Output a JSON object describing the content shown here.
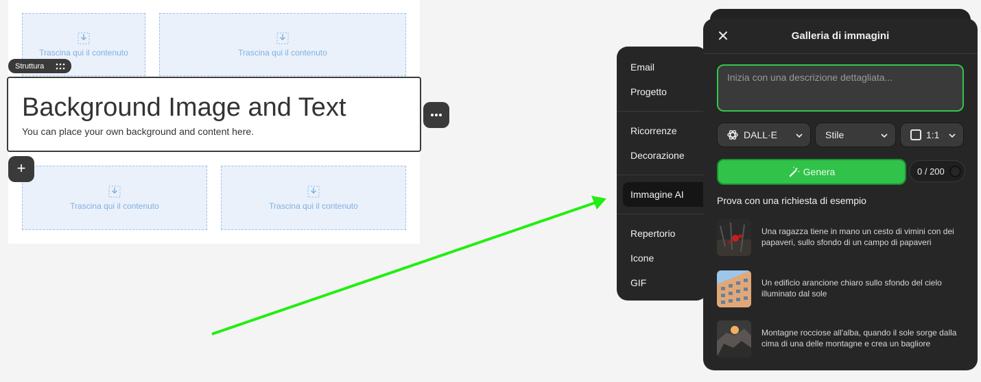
{
  "canvas": {
    "dropzone_text": "Trascina qui il contenuto",
    "structure_badge": "Struttura",
    "block": {
      "headline": "Background Image and Text",
      "subtext": "You can place your own background and content here."
    },
    "add_button": "+"
  },
  "side_menu": {
    "items": [
      {
        "label": "Email"
      },
      {
        "label": "Progetto"
      },
      {
        "label": "Ricorrenze"
      },
      {
        "label": "Decorazione"
      },
      {
        "label": "Immagine AI",
        "active": true
      },
      {
        "label": "Repertorio"
      },
      {
        "label": "Icone"
      },
      {
        "label": "GIF"
      }
    ]
  },
  "gallery": {
    "title": "Galleria di immagini",
    "prompt_placeholder": "Inizia con una descrizione dettagliata...",
    "model": "DALL·E",
    "style": "Stile",
    "ratio": "1:1",
    "generate_label": "Genera",
    "counter": "0 / 200",
    "examples_title": "Prova con una richiesta di esempio",
    "examples": [
      {
        "text": "Una ragazza tiene in mano un cesto di vimini con dei papaveri, sullo sfondo di un campo di papaveri"
      },
      {
        "text": "Un edificio arancione chiaro sullo sfondo del cielo illuminato dal sole"
      },
      {
        "text": "Montagne rocciose all'alba, quando il sole sorge dalla cima di una delle montagne e crea un bagliore"
      }
    ]
  },
  "colors": {
    "accent_green": "#31c24a",
    "panel_bg": "#262626",
    "dropzone_bg": "#eaf1fb",
    "arrow": "#22ee11"
  }
}
